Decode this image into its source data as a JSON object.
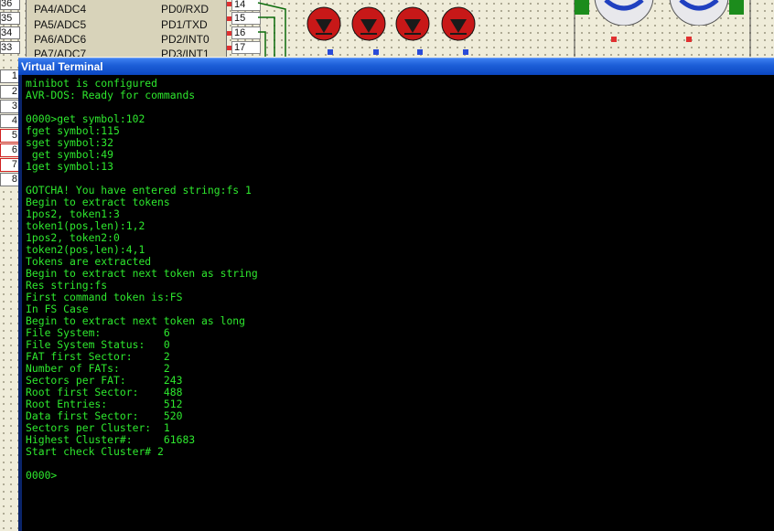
{
  "schematic": {
    "left_pins": [
      "PA4/ADC4",
      "PA5/ADC5",
      "PA6/ADC6",
      "PA7/ADC7"
    ],
    "right_pins": [
      "PD0/RXD",
      "PD1/TXD",
      "PD2/INT0",
      "PD3/INT1"
    ],
    "pin_numbers": [
      "14",
      "15",
      "16",
      "17"
    ],
    "edge_numbers_top": [
      "36",
      "35",
      "34",
      "33"
    ],
    "edge_numbers_side": [
      "1",
      "2",
      "3",
      "4",
      "5",
      "6",
      "7",
      "8"
    ]
  },
  "window": {
    "title": "Virtual Terminal"
  },
  "terminal": {
    "lines": [
      "minibot is configured",
      "AVR-DOS: Ready for commands",
      "",
      "0000>get symbol:102",
      "fget symbol:115",
      "sget symbol:32",
      " get symbol:49",
      "1get symbol:13",
      "",
      "GOTCHA! You have entered string:fs 1",
      "Begin to extract tokens",
      "1pos2, token1:3",
      "token1(pos,len):1,2",
      "1pos2, token2:0",
      "token2(pos,len):4,1",
      "Tokens are extracted",
      "Begin to extract next token as string",
      "Res string:fs",
      "First command token is:FS",
      "In FS Case",
      "Begin to extract next token as long",
      "File System:          6",
      "File System Status:   0",
      "FAT first Sector:     2",
      "Number of FATs:       2",
      "Sectors per FAT:      243",
      "Root first Sector:    488",
      "Root Entries:         512",
      "Data first Sector:    520",
      "Sectors per Cluster:  1",
      "Highest Cluster#:     61683",
      "Start check Cluster# 2",
      "",
      "0000>"
    ]
  },
  "colors": {
    "terminal_text": "#2ee82e",
    "terminal_bg": "#000000",
    "titlebar": "#0b47c2"
  }
}
